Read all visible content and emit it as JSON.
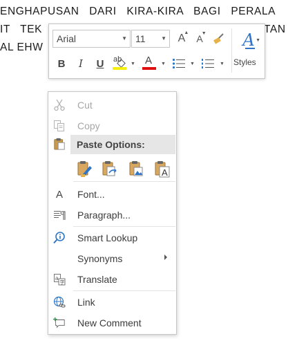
{
  "document": {
    "lines": [
      "ENGHAPUSAN   DARI   KIRA-KIRA   BAGI   PERALA",
      "IT   TEK",
      "TAN",
      "AL EHW"
    ]
  },
  "mini_toolbar": {
    "font_name": "Arial",
    "font_size": "11",
    "grow_font_label": "A",
    "shrink_font_label": "A",
    "bold_label": "B",
    "italic_label": "I",
    "underline_label": "U",
    "highlight_label": "ab",
    "font_color_label": "A",
    "styles_glyph": "A",
    "styles_label": "Styles",
    "colors": {
      "highlight": "#f5f00a",
      "font_color": "#e01010",
      "styles": "#2e75c7"
    }
  },
  "context_menu": {
    "cut": "Cut",
    "copy": "Copy",
    "paste_options_header": "Paste Options:",
    "paste_icons": [
      "paste-keep-source-formatting-icon",
      "paste-merge-formatting-icon",
      "paste-picture-icon",
      "paste-keep-text-only-icon"
    ],
    "font": "Font...",
    "paragraph": "Paragraph...",
    "smart_lookup": "Smart Lookup",
    "synonyms": "Synonyms",
    "translate": "Translate",
    "link": "Link",
    "new_comment": "New Comment",
    "font_icon_label": "A"
  }
}
